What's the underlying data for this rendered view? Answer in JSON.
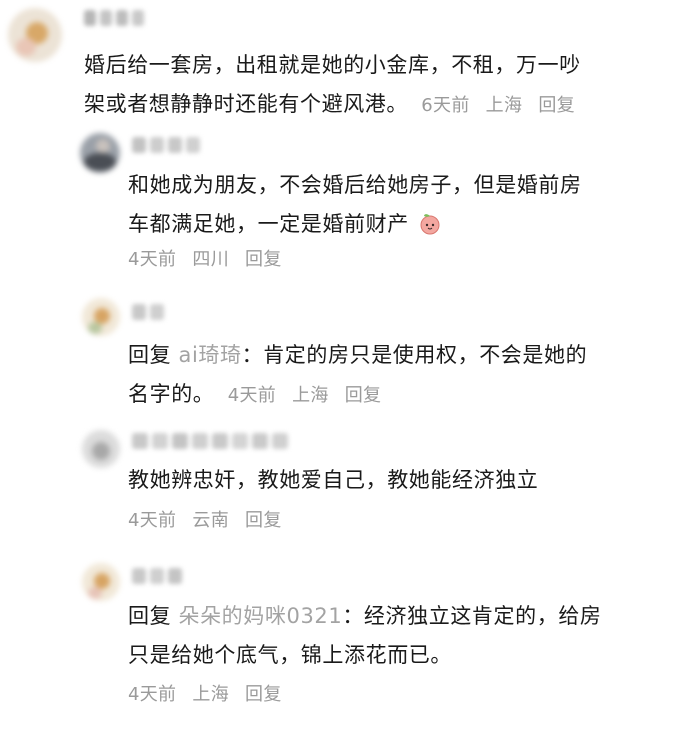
{
  "comments": [
    {
      "text": "婚后给一套房，出租就是她的小金库，不租，万一吵架或者想静静时还能有个避风港。",
      "line1": "婚后给一套房，出租就是她的小金库，不租，万一吵",
      "line2": "架或者想静静时还能有个避风港。",
      "time": "6天前",
      "location": "上海",
      "reply_label": "回复"
    },
    {
      "line1": "和她成为朋友，不会婚后给她房子，但是婚前房",
      "line2": "车都满足她，一定是婚前财产",
      "emoji": "peach-emoji",
      "time": "4天前",
      "location": "四川",
      "reply_label": "回复"
    },
    {
      "prefix": "回复 ",
      "mention": "ai琦琦",
      "line1_rest": "：肯定的房只是使用权，不会是她的",
      "line2": "名字的。",
      "time": "4天前",
      "location": "上海",
      "reply_label": "回复"
    },
    {
      "line1": "教她辨忠奸，教她爱自己，教她能经济独立",
      "time": "4天前",
      "location": "云南",
      "reply_label": "回复"
    },
    {
      "prefix": "回复 ",
      "mention": "朵朵的妈咪0321",
      "line1_rest": "：经济独立这肯定的，给房",
      "line2": "只是给她个底气，锦上添花而已。",
      "time": "4天前",
      "location": "上海",
      "reply_label": "回复"
    }
  ]
}
